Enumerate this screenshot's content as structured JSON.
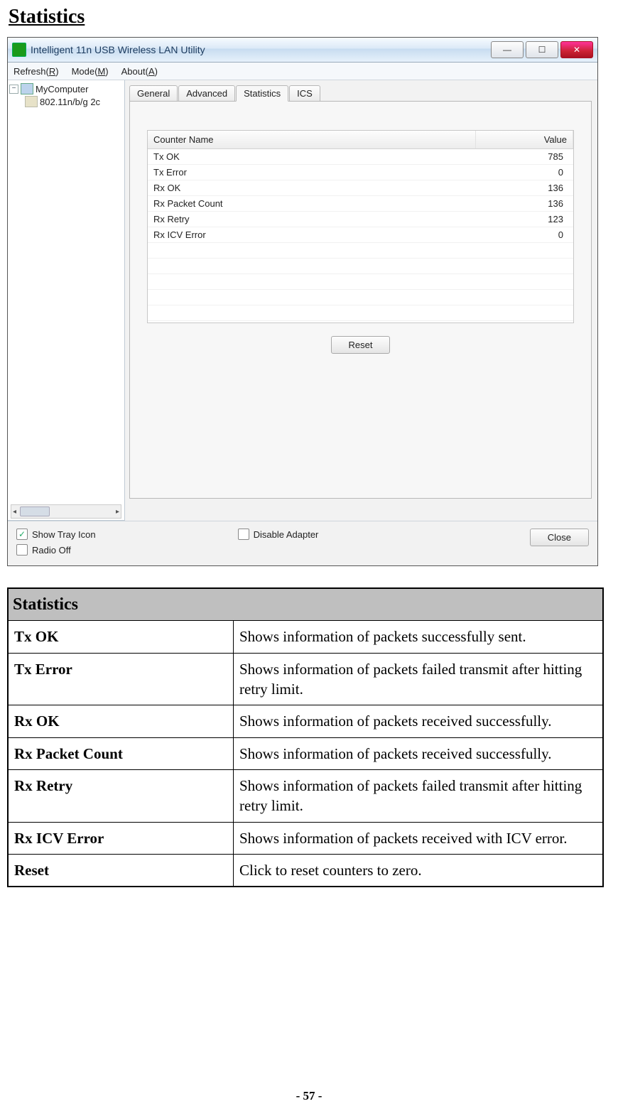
{
  "page": {
    "heading": "Statistics",
    "footer": "- 57 -"
  },
  "window": {
    "title": "Intelligent 11n USB Wireless LAN Utility",
    "menu": {
      "refresh_html": "Refresh(<u>R</u>)",
      "mode_html": "Mode(<u>M</u>)",
      "about_html": "About(<u>A</u>)"
    },
    "tree": {
      "root": "MyComputer",
      "child": "802.11n/b/g 2c",
      "scroll_label": "...",
      "expander": "−"
    },
    "tabs": {
      "general": "General",
      "advanced": "Advanced",
      "statistics": "Statistics",
      "ics": "ICS"
    },
    "grid": {
      "head_name": "Counter Name",
      "head_value": "Value",
      "rows": [
        {
          "name": "Tx OK",
          "value": "785"
        },
        {
          "name": "Tx Error",
          "value": "0"
        },
        {
          "name": "Rx OK",
          "value": "136"
        },
        {
          "name": "Rx Packet Count",
          "value": "136"
        },
        {
          "name": "Rx Retry",
          "value": "123"
        },
        {
          "name": "Rx ICV Error",
          "value": "0"
        }
      ]
    },
    "reset_label": "Reset",
    "footer": {
      "show_tray": "Show Tray Icon",
      "radio_off": "Radio Off",
      "disable": "Disable Adapter",
      "close": "Close"
    },
    "win_buttons": {
      "min": "—",
      "max": "☐",
      "close": "✕"
    }
  },
  "doc_table": {
    "section": "Statistics",
    "rows": [
      {
        "term": "Tx OK",
        "desc": "Shows information of packets successfully sent."
      },
      {
        "term": "Tx Error",
        "desc": "Shows information of packets failed transmit after hitting retry limit."
      },
      {
        "term": "Rx OK",
        "desc": "Shows information of packets received successfully."
      },
      {
        "term": "Rx Packet Count",
        "desc": "Shows information of packets received successfully."
      },
      {
        "term": "Rx Retry",
        "desc": "Shows information of packets failed transmit after hitting retry limit."
      },
      {
        "term": "Rx ICV Error",
        "desc": "Shows information of packets received with ICV error."
      },
      {
        "term": "Reset",
        "desc": "Click to reset counters to zero."
      }
    ]
  }
}
